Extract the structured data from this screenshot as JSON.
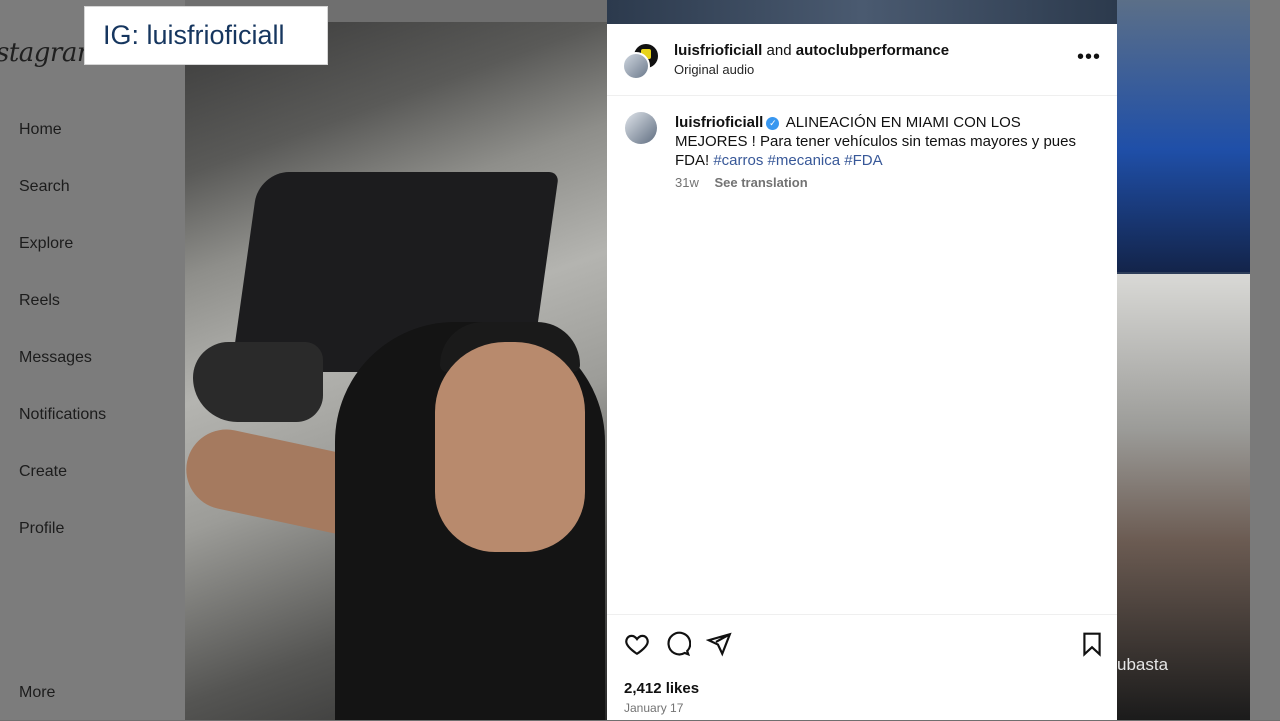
{
  "badge": "IG: luisfrioficiall",
  "sidebar": {
    "logo": "Instagram",
    "items": [
      {
        "label": "Home"
      },
      {
        "label": "Search"
      },
      {
        "label": "Explore"
      },
      {
        "label": "Reels"
      },
      {
        "label": "Messages"
      },
      {
        "label": "Notifications"
      },
      {
        "label": "Create"
      },
      {
        "label": "Profile"
      },
      {
        "label": "More"
      }
    ]
  },
  "post": {
    "header": {
      "user1": "luisfrioficiall",
      "and": "and",
      "user2": "autoclubperformance",
      "audio": "Original audio",
      "more_icon": "more-horizontal-icon"
    },
    "caption": {
      "user": "luisfrioficiall",
      "text": "ALINEACIÓN EN MIAMI CON LOS MEJORES ! Para tener vehículos sin temas mayores y pues FDA!",
      "tags": [
        "#carros",
        "#mecanica",
        "#FDA"
      ],
      "age": "31w",
      "see_translation": "See translation"
    },
    "likes": "2,412 likes",
    "date": "January 17"
  },
  "background": {
    "thumb_text": "ubasta"
  },
  "colors": {
    "accent_link": "#385898",
    "verified": "#3897f0",
    "badge_text": "#16365f"
  }
}
